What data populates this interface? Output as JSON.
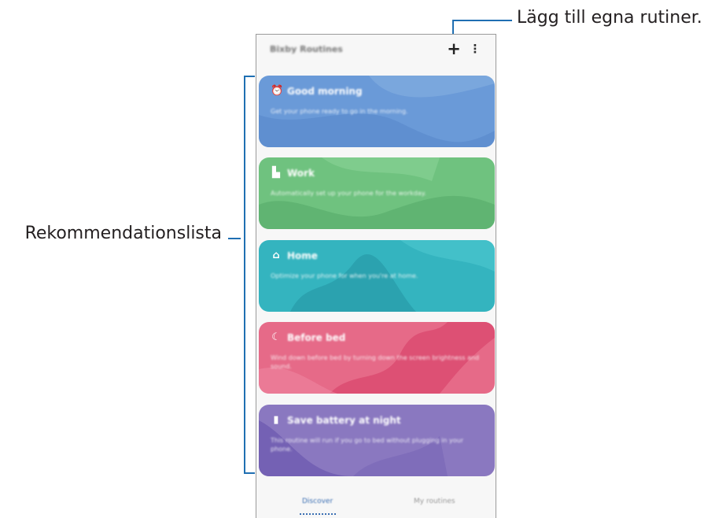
{
  "callouts": {
    "add_own": "Lägg till egna rutiner.",
    "recommendations": "Rekommendationslista"
  },
  "header": {
    "title": "Bixby Routines",
    "add_icon": "plus-icon",
    "more_icon": "more-vert-icon"
  },
  "cards": [
    {
      "title": "Good morning",
      "description": "Get your phone ready to go in the morning.",
      "icon": "alarm-icon",
      "color": "#6a9ad8"
    },
    {
      "title": "Work",
      "description": "Automatically set up your phone for the workday.",
      "icon": "building-icon",
      "color": "#6fc27f"
    },
    {
      "title": "Home",
      "description": "Optimize your phone for when you're at home.",
      "icon": "home-icon",
      "color": "#34b4bf"
    },
    {
      "title": "Before bed",
      "description": "Wind down before bed by turning down the screen brightness and sound.",
      "icon": "moon-icon",
      "color": "#e66a88"
    },
    {
      "title": "Save battery at night",
      "description": "This routine will run if you go to bed without plugging in your phone.",
      "icon": "battery-icon",
      "color": "#8a78c0"
    }
  ],
  "tabs": {
    "discover": "Discover",
    "my_routines": "My routines"
  },
  "colors": {
    "callout_line": "#1f6fb2",
    "tab_active": "#3b6fb3"
  }
}
